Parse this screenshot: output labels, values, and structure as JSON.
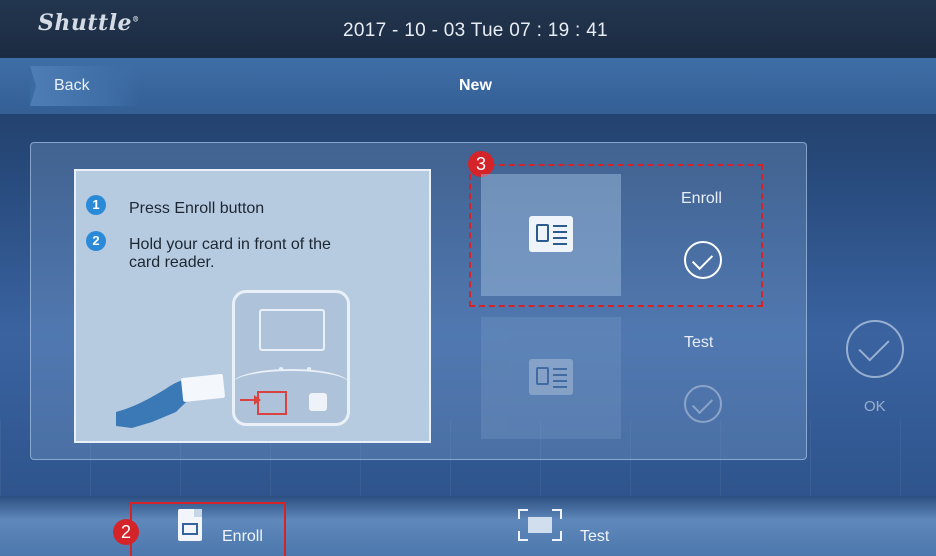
{
  "header": {
    "logo": "Shuttle",
    "datetime": "2017 - 10 - 03  Tue  07 : 19 : 41"
  },
  "nav": {
    "back_label": "Back",
    "title": "New"
  },
  "instructions": {
    "step1_num": "1",
    "step1_text": "Press Enroll button",
    "step2_num": "2",
    "step2_text_line1": "Hold your card in front of the",
    "step2_text_line2": "card reader."
  },
  "options": {
    "enroll_label": "Enroll",
    "test_label": "Test"
  },
  "ok_label": "OK",
  "annotations": {
    "badge_2": "2",
    "badge_3": "3"
  },
  "bottom_tabs": {
    "enroll": "Enroll",
    "test": "Test"
  },
  "icons": [
    "card-icon",
    "check-icon",
    "hand-icon",
    "document-icon",
    "scan-icon"
  ],
  "colors": {
    "annotation_red": "#d4242a",
    "step_blue": "#2a8ad8"
  }
}
